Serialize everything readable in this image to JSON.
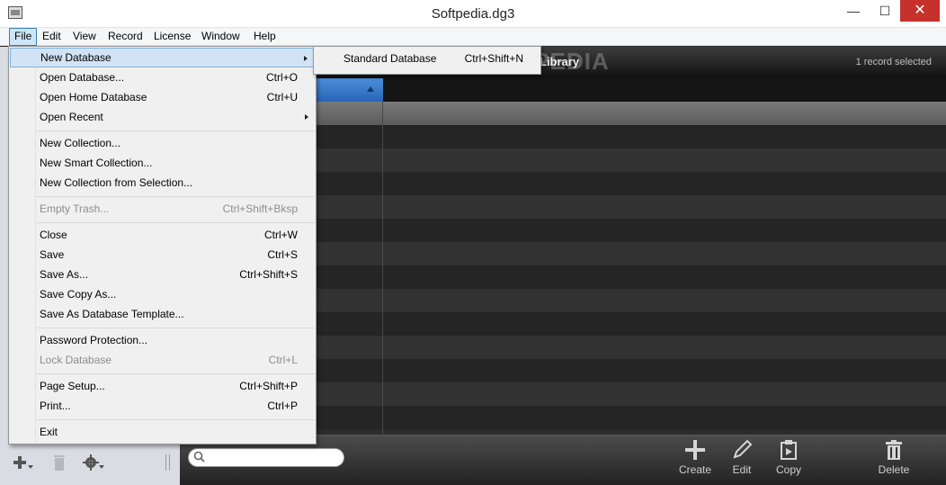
{
  "window": {
    "title": "Softpedia.dg3",
    "minimize_glyph": "—",
    "maximize_glyph": "☐",
    "close_glyph": "✕"
  },
  "menubar": [
    "File",
    "Edit",
    "View",
    "Record",
    "License",
    "Window",
    "Help"
  ],
  "file_menu": [
    {
      "label": "New Database",
      "shortcut": "",
      "submenu": true,
      "highlighted": true
    },
    {
      "label": "Open Database...",
      "shortcut": "Ctrl+O"
    },
    {
      "label": "Open Home Database",
      "shortcut": "Ctrl+U"
    },
    {
      "label": "Open Recent",
      "shortcut": "",
      "submenu": true
    },
    {
      "label": "New Collection...",
      "shortcut": ""
    },
    {
      "label": "New Smart Collection...",
      "shortcut": ""
    },
    {
      "label": "New Collection from Selection...",
      "shortcut": ""
    },
    {
      "label": "Empty Trash...",
      "shortcut": "Ctrl+Shift+Bksp",
      "disabled": true
    },
    {
      "label": "Close",
      "shortcut": "Ctrl+W"
    },
    {
      "label": "Save",
      "shortcut": "Ctrl+S"
    },
    {
      "label": "Save As...",
      "shortcut": "Ctrl+Shift+S"
    },
    {
      "label": "Save Copy As...",
      "shortcut": ""
    },
    {
      "label": "Save As Database Template...",
      "shortcut": ""
    },
    {
      "label": "Password Protection...",
      "shortcut": ""
    },
    {
      "label": "Lock Database",
      "shortcut": "Ctrl+L",
      "disabled": true
    },
    {
      "label": "Page Setup...",
      "shortcut": "Ctrl+Shift+P"
    },
    {
      "label": "Print...",
      "shortcut": "Ctrl+P"
    },
    {
      "label": "Exit",
      "shortcut": ""
    }
  ],
  "submenu": {
    "label": "Standard Database",
    "shortcut": "Ctrl+Shift+N"
  },
  "library": {
    "title": "Library",
    "watermark": "SOFTPEDIA",
    "record_status": "1 record selected"
  },
  "toolbar": {
    "create": "Create",
    "edit": "Edit",
    "copy": "Copy",
    "delete": "Delete"
  },
  "search": {
    "value": ""
  },
  "colors": {
    "accent_blue": "#2a64b8",
    "close_red": "#c7312c"
  }
}
